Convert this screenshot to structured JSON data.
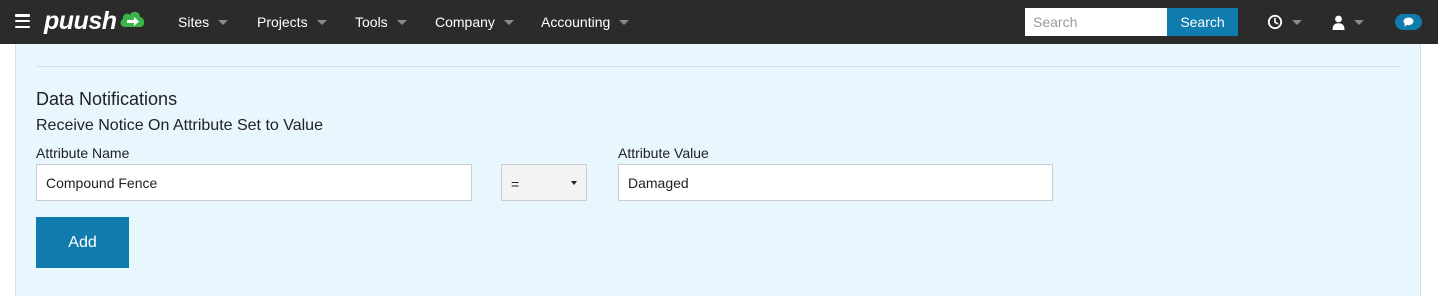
{
  "header": {
    "logo": "puush",
    "nav": [
      {
        "label": "Sites"
      },
      {
        "label": "Projects"
      },
      {
        "label": "Tools"
      },
      {
        "label": "Company"
      },
      {
        "label": "Accounting"
      }
    ],
    "search": {
      "placeholder": "Search",
      "value": "",
      "button_label": "Search"
    },
    "icons": [
      "menu-icon",
      "history-icon",
      "user-icon",
      "chat-icon"
    ],
    "colors": {
      "bar": "#2b2b2b",
      "accent": "#0f7cad",
      "logo_cloud": "#3cb44a"
    }
  },
  "main": {
    "section_title": "Data Notifications",
    "subtitle": "Receive Notice On Attribute Set to Value",
    "attribute_name": {
      "label": "Attribute Name",
      "value": "Compound Fence"
    },
    "operator": {
      "value": "="
    },
    "attribute_value": {
      "label": "Attribute Value",
      "value": "Damaged"
    },
    "add_label": "Add",
    "colors": {
      "panel_bg": "#e8f6fd"
    }
  }
}
